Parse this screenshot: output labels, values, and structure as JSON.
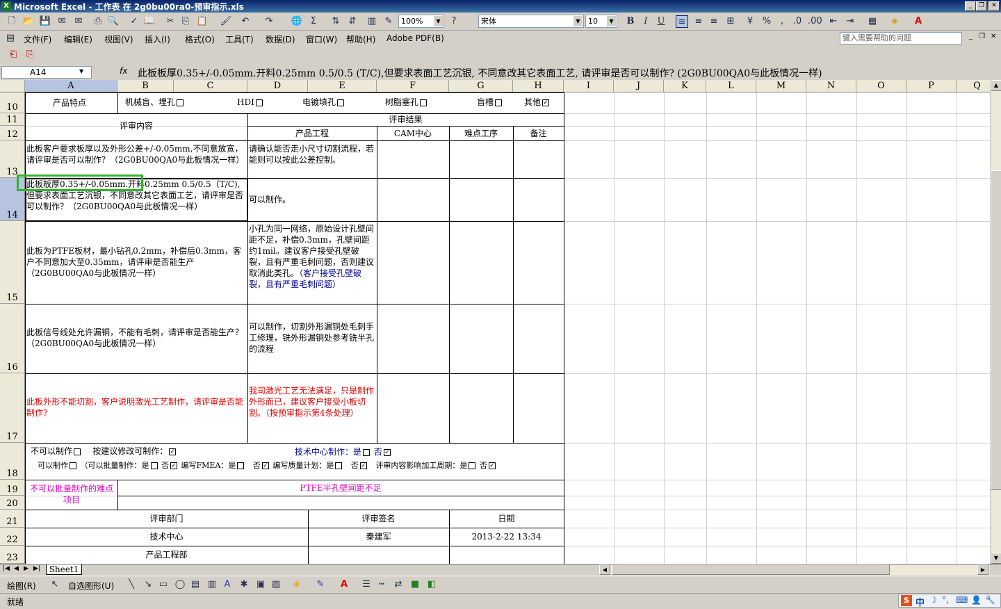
{
  "title": "Microsoft Excel - 工作表 在 2g0bu00ra0-预审指示.xls",
  "formatting": {
    "zoom": "100%",
    "font": "宋体",
    "size": "10"
  },
  "menu": [
    "文件(F)",
    "编辑(E)",
    "视图(V)",
    "插入(I)",
    "格式(O)",
    "工具(T)",
    "数据(D)",
    "窗口(W)",
    "帮助(H)",
    "Adobe PDF(B)"
  ],
  "help_placeholder": "键入需要帮助的问题",
  "namebox": "A14",
  "fx": "fx",
  "formula": "此板板厚0.35+/-0.05mm.开料0.25mm 0.5/0.5 (T/C),但要求表面工艺沉银, 不同意改其它表面工艺, 请评审是否可以制作? (2G0BU00QA0与此板情况一样)",
  "columns": [
    "A",
    "B",
    "C",
    "D",
    "E",
    "F",
    "G",
    "H",
    "I",
    "J",
    "K",
    "L",
    "M",
    "N",
    "O",
    "P",
    "Q"
  ],
  "rows": [
    "10",
    "11",
    "12",
    "13",
    "14",
    "15",
    "16",
    "17",
    "18",
    "19",
    "20",
    "21",
    "22",
    "23"
  ],
  "r10": {
    "label": "产品特点",
    "b": "机械盲、埋孔",
    "c": "HDI",
    "d": "电镀填孔",
    "e": "树脂塞孔",
    "g": "盲槽",
    "h": "其他"
  },
  "r11": {
    "a": "评审内容",
    "d": "评审结果"
  },
  "r12": {
    "d": "产品工程",
    "f": "CAM中心",
    "g": "难点工序",
    "h": "备注"
  },
  "r13": {
    "a": "此板客户要求板厚以及外形公差+/-0.05mm,不同意放宽，请评审是否可以制作？（2G0BU00QA0与此板情况一样）",
    "d": "请确认能否走小尺寸切割流程，若能则可以按此公差控制。"
  },
  "r14": {
    "a": "此板板厚0.35+/-0.05mm.开料0.25mm 0.5/0.5（T/C),但要求表面工艺沉银，不同意改其它表面工艺，请评审是否可以制作？（2G0BU00QA0与此板情况一样）",
    "d": "可以制作。"
  },
  "r15": {
    "a": "此板为PTFE板材，最小钻孔0.2mm，补偿后0.3mm，客户不同意加大至0.35mm，请评审是否能生产（2G0BU00QA0与此板情况一样）",
    "d1": "小孔为同一网络，原始设计孔壁间距不足，补偿0.3mm，孔壁间距约1mil。建议客户接受孔壁破裂，且有严重毛刺问题，否则建议取消此类孔。",
    "d2": "（客户接受孔壁破裂，且有严重毛刺问题）"
  },
  "r16": {
    "a": "此板信号线处允许漏铜，不能有毛刺，请评审是否能生产？（2G0BU00QA0与此板情况一样）",
    "d": "可以制作，切割外形漏铜处毛刺手工修理，铣外形漏铜处参考铣半孔的流程"
  },
  "r17": {
    "a": "此板外形不能切割，客户说明激光工艺制作，请评审是否能制作?",
    "d": "我司激光工艺无法满足，只是制作外形而已，建议客户接受小板切割。（按预审指示第4条处理）"
  },
  "r18": {
    "no": "不可以制作",
    "mod": "按建议修改可制作：",
    "tech": "技术中心制作：是",
    "no2": "否",
    "can": "可以制作",
    "batch": "（可以批量制作：是",
    "fou": "否",
    "fmea": "编写FMEA：是",
    "qp": "编写质量计划：是",
    "cycle": "评审内容影响加工周期：是"
  },
  "r19": {
    "a": "不可以批量制作的难点项目",
    "b": "PTFE半孔壁间距不足"
  },
  "r21": {
    "dept": "评审部门",
    "sign": "评审签名",
    "date": "日期"
  },
  "r22": {
    "dept": "技术中心",
    "sign": "秦建军",
    "date": "2013-2-22 13:34"
  },
  "r23": {
    "dept": "产品工程部"
  },
  "sheet_tab": "Sheet1",
  "drawbar": {
    "draw": "绘图(R)",
    "autoshape": "自选图形(U)"
  },
  "status": "就绪",
  "ime": "中"
}
